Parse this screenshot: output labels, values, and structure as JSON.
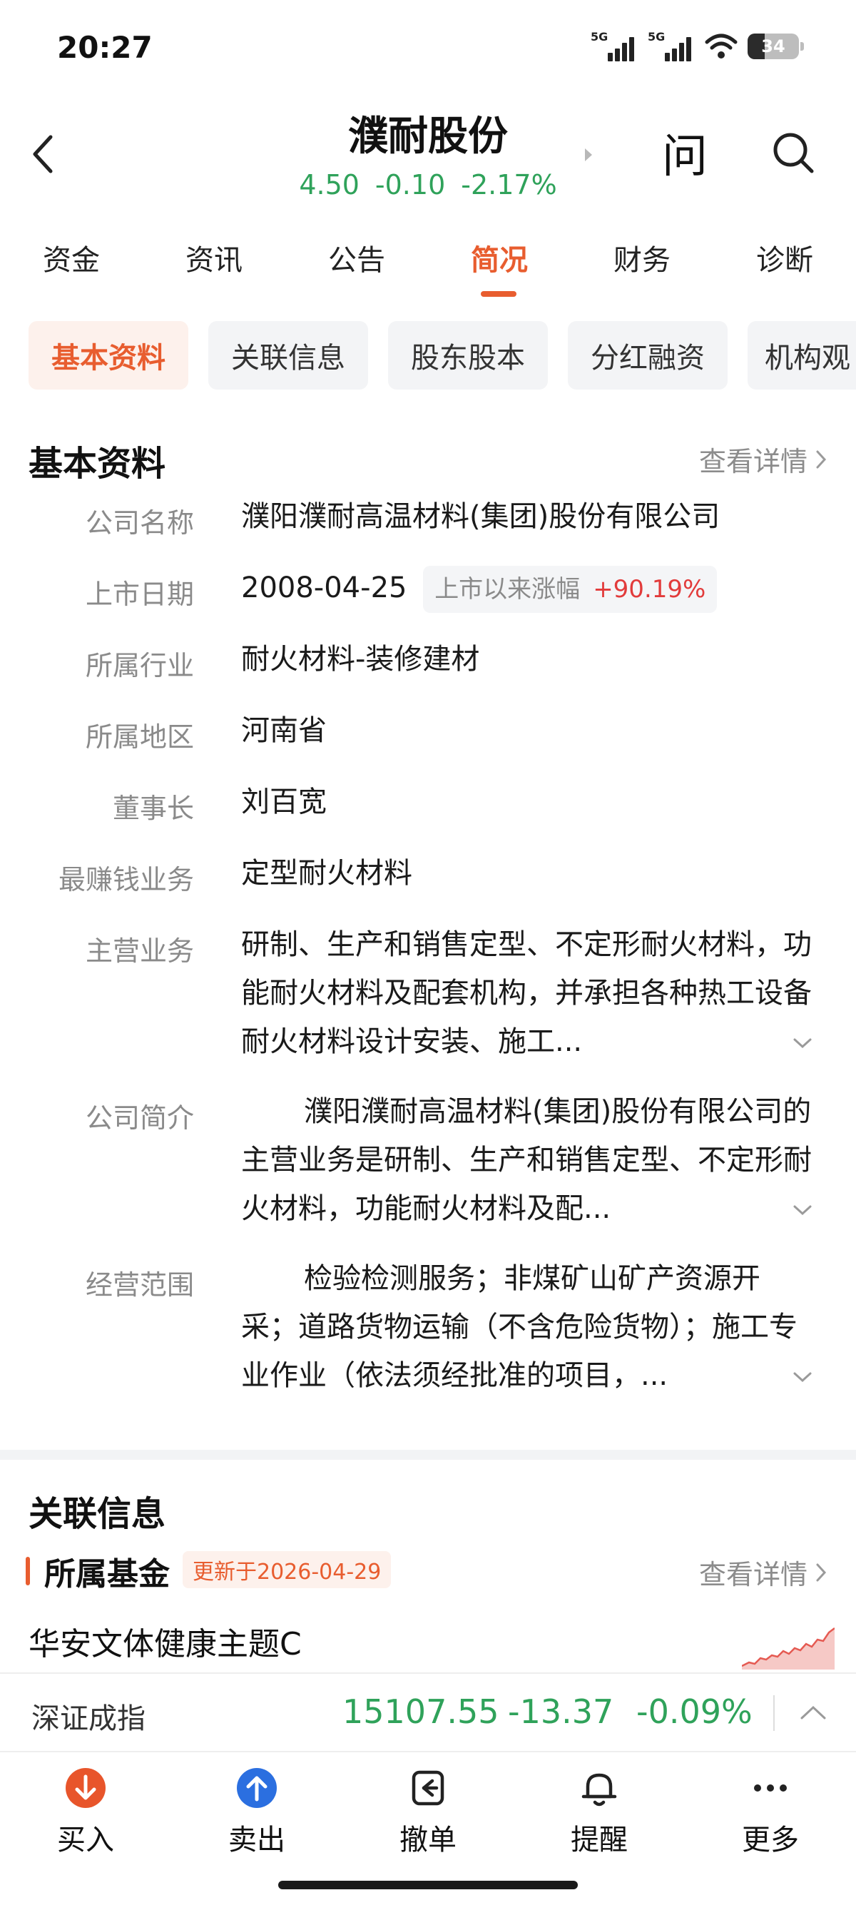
{
  "status_bar": {
    "time": "20:27",
    "network_1": "5G",
    "network_2": "5G",
    "battery": "34"
  },
  "header": {
    "stock_name": "濮耐股份",
    "price": "4.50",
    "change": "-0.10",
    "change_pct": "-2.17%",
    "ask_label": "问",
    "quote_color": "#2fa25a"
  },
  "tabs": [
    {
      "label": "资金"
    },
    {
      "label": "资讯"
    },
    {
      "label": "公告"
    },
    {
      "label": "简况",
      "active": true
    },
    {
      "label": "财务"
    },
    {
      "label": "诊断"
    }
  ],
  "subtabs": [
    {
      "label": "基本资料",
      "active": true
    },
    {
      "label": "关联信息"
    },
    {
      "label": "股东股本"
    },
    {
      "label": "分红融资"
    },
    {
      "label": "机构观"
    }
  ],
  "basic_info": {
    "title": "基本资料",
    "more_label": "查看详情",
    "rows": [
      {
        "key": "公司名称",
        "value": "濮阳濮耐高温材料(集团)股份有限公司"
      },
      {
        "key": "上市日期",
        "value": "2008-04-25",
        "badge_label": "上市以来涨幅",
        "badge_value": "+90.19%"
      },
      {
        "key": "所属行业",
        "value": "耐火材料-装修建材"
      },
      {
        "key": "所属地区",
        "value": "河南省"
      },
      {
        "key": "董事长",
        "value": "刘百宽"
      },
      {
        "key": "最赚钱业务",
        "value": "定型耐火材料"
      },
      {
        "key": "主营业务",
        "value": "研制、生产和销售定型、不定形耐火材料，功能耐火材料及配套机构，并承担各种热工设备耐火材料设计安装、施工..."
      },
      {
        "key": "公司简介",
        "value": "濮阳濮耐高温材料(集团)股份有限公司的主营业务是研制、生产和销售定型、不定形耐火材料，功能耐火材料及配..."
      },
      {
        "key": "经营范围",
        "value": "检验检测服务；非煤矿山矿产资源开采；道路货物运输（不含危险货物）；施工专业作业（依法须经批准的项目，..."
      }
    ]
  },
  "related": {
    "title": "关联信息",
    "fund_section_title": "所属基金",
    "updated_badge": "更新于2026-04-29",
    "more_label": "查看详情",
    "fund_name": "华安文体健康主题C"
  },
  "index_bar": {
    "name": "深证成指",
    "value": "15107.55",
    "change": "-13.37",
    "change_pct": "-0.09%"
  },
  "bottom_nav": [
    {
      "label": "买入",
      "icon": "buy-icon"
    },
    {
      "label": "卖出",
      "icon": "sell-icon"
    },
    {
      "label": "撤单",
      "icon": "cancel-order-icon"
    },
    {
      "label": "提醒",
      "icon": "bell-icon"
    },
    {
      "label": "更多",
      "icon": "more-icon"
    }
  ],
  "colors": {
    "accent": "#e85d2f",
    "down": "#2fa25a",
    "up": "#e23b3b"
  }
}
